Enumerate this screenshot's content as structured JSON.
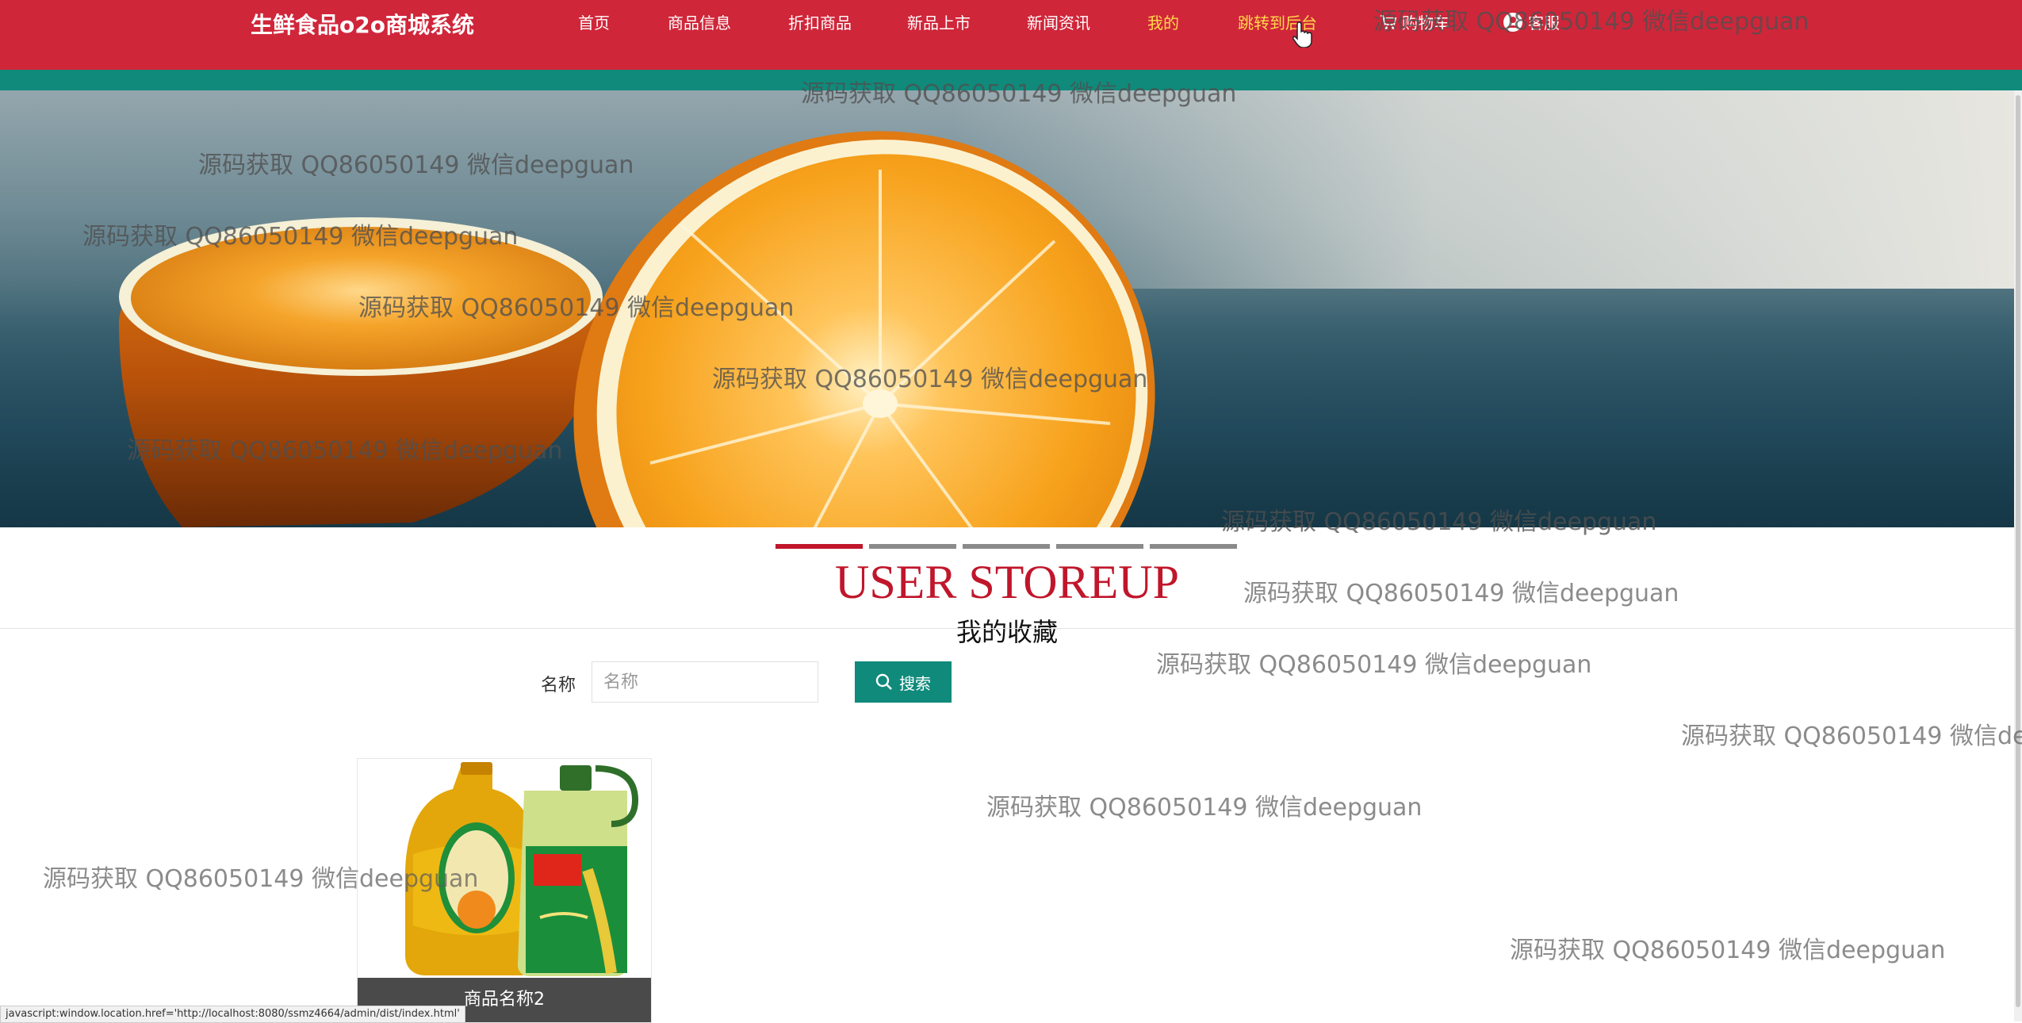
{
  "header": {
    "brand": "生鲜食品o2o商城系统",
    "nav": [
      {
        "label": "首页",
        "active": false
      },
      {
        "label": "商品信息",
        "active": false
      },
      {
        "label": "折扣商品",
        "active": false
      },
      {
        "label": "新品上市",
        "active": false
      },
      {
        "label": "新闻资讯",
        "active": false
      },
      {
        "label": "我的",
        "active": true
      },
      {
        "label": "跳转到后台",
        "active": true
      }
    ],
    "cart_label": "购物车",
    "service_label": "客服"
  },
  "slider": {
    "count": 5,
    "active_index": 0
  },
  "section": {
    "title": "USER STOREUP",
    "subtitle": "我的收藏"
  },
  "search": {
    "label": "名称",
    "placeholder": "名称",
    "value": "",
    "button_label": "搜索"
  },
  "products": [
    {
      "name": "商品名称2"
    }
  ],
  "status_bar": {
    "text": "javascript:window.location.href='http://localhost:8080/ssmz4664/admin/dist/index.html'"
  },
  "watermark": {
    "text": "源码获取 QQ86050149 微信deepguan"
  },
  "colors": {
    "primary_red": "#d0263a",
    "teal": "#0f8a7b",
    "title_red": "#c0162b",
    "active_nav": "#ffd94a"
  }
}
